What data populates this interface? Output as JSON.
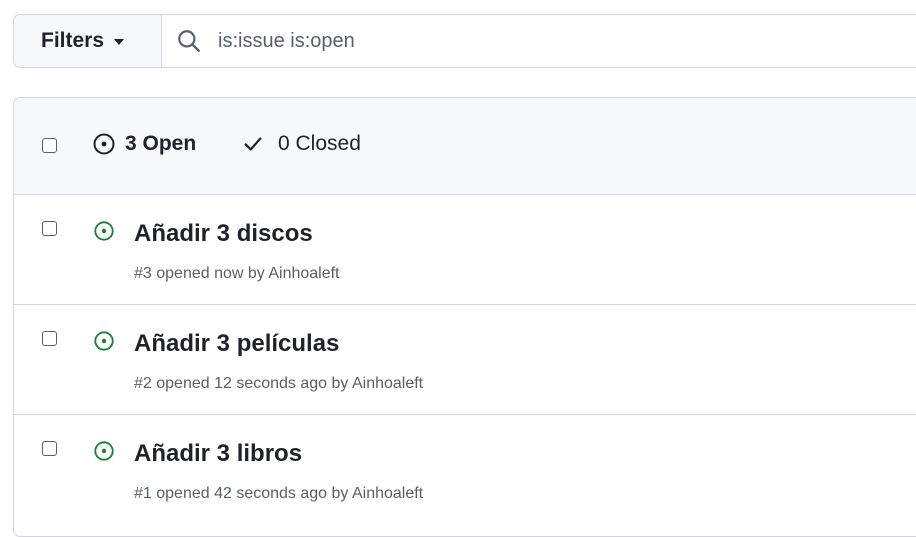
{
  "filter_bar": {
    "filters_label": "Filters",
    "search_value": "is:issue is:open"
  },
  "issues_header": {
    "open_label": "3 Open",
    "closed_label": "0 Closed"
  },
  "issues": [
    {
      "title": "Añadir 3 discos",
      "meta": "#3 opened now by Ainhoaleft"
    },
    {
      "title": "Añadir 3 películas",
      "meta": "#2 opened 12 seconds ago by Ainhoaleft"
    },
    {
      "title": "Añadir 3 libros",
      "meta": "#1 opened 42 seconds ago by Ainhoaleft"
    }
  ],
  "colors": {
    "open_icon": "#1a7f37",
    "border": "#d0d7de",
    "header_bg": "#f6f8fa",
    "muted_text": "#57606a"
  }
}
